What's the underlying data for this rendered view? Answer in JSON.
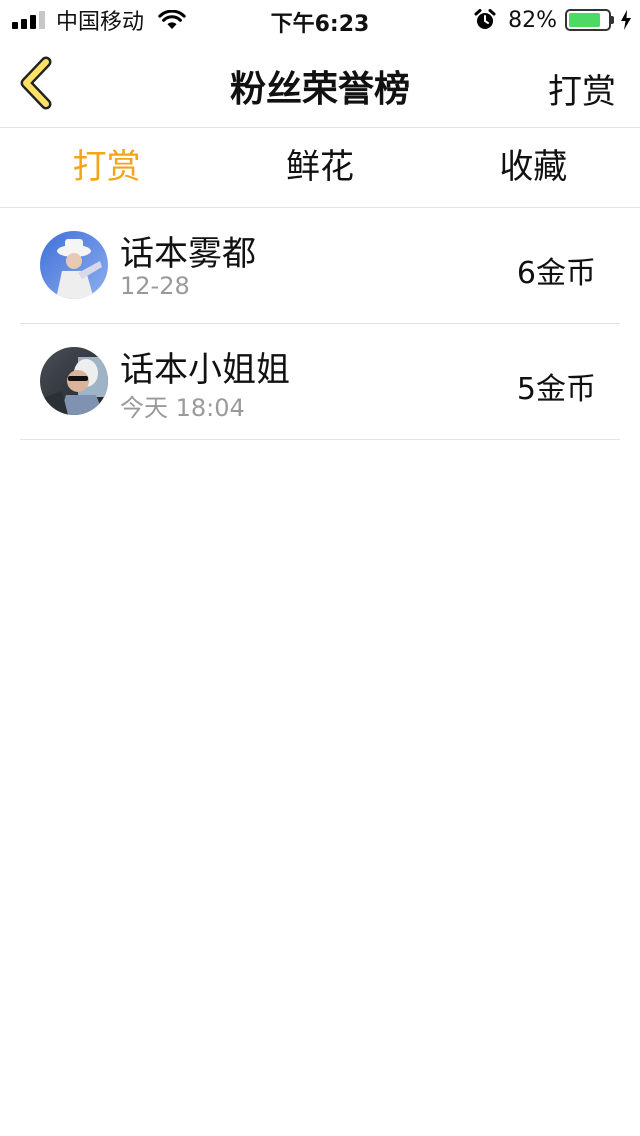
{
  "status_bar": {
    "carrier": "中国移动",
    "time": "下午6:23",
    "battery_percent": "82%",
    "battery_level": 0.82,
    "icons": [
      "signal-icon",
      "wifi-icon",
      "alarm-icon",
      "battery-icon",
      "charging-bolt-icon"
    ]
  },
  "nav": {
    "back_icon": "chevron-left-icon",
    "title": "粉丝荣誉榜",
    "action": "打赏"
  },
  "tabs": [
    {
      "label": "打赏",
      "active": true
    },
    {
      "label": "鲜花",
      "active": false
    },
    {
      "label": "收藏",
      "active": false
    }
  ],
  "list": [
    {
      "name": "话本雾都",
      "time": "12-28",
      "amount": "6金币"
    },
    {
      "name": "话本小姐姐",
      "time": "今天 18:04",
      "amount": "5金币"
    }
  ],
  "colors": {
    "accent": "#f4a516",
    "back_icon_fill": "#ffe066",
    "divider": "#e3e3e3",
    "secondary_text": "#9a9a9a",
    "battery_fill": "#4cd964"
  }
}
